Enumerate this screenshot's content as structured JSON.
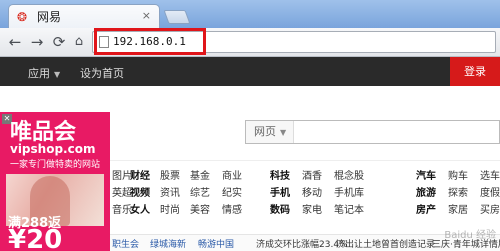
{
  "browser": {
    "tab": {
      "title": "网易",
      "favicon": "netease-logo-icon",
      "close": "×"
    },
    "nav": {
      "back": "←",
      "forward": "→",
      "reload": "⟳"
    },
    "omnibox": {
      "url": "192.168.0.1"
    },
    "highlight_color": "#e0151a"
  },
  "sitenav": {
    "apps": "应用",
    "set_home": "设为首页",
    "login": "登录",
    "login_color": "#d61a1a"
  },
  "ad": {
    "brand": "唯品会",
    "site": "vipshop.com",
    "slogan": "一家专门做特卖的网站",
    "promo": "满288返",
    "big": "¥20",
    "color": "#e81a64"
  },
  "search": {
    "type": "网页"
  },
  "links": {
    "col1": [
      "图片",
      "英超",
      "音乐"
    ],
    "col2": [
      "财经",
      "视频",
      "女人"
    ],
    "col3": [
      "股票",
      "资讯",
      "时尚"
    ],
    "col4": [
      "基金",
      "综艺",
      "美容"
    ],
    "col5": [
      "商业",
      "纪实",
      "情感"
    ],
    "col6": [
      "科技",
      "手机",
      "数码"
    ],
    "col7": [
      "酒香",
      "移动",
      "家电"
    ],
    "col8": [
      "棍念股",
      "手机库",
      "笔记本"
    ],
    "col9": [
      "汽车",
      "旅游",
      "房产"
    ],
    "col10": [
      "购车",
      "探索",
      "家居"
    ],
    "col11": [
      "选车",
      "度假",
      "买房"
    ]
  },
  "ticker": {
    "items": [
      "职生会",
      "绿城海新",
      "畅游中国",
      "济成交环比涨幅23.4%",
      "济出让土地曾首创造记录",
      "三庆·青年城详情展示"
    ]
  },
  "watermark": "Baidu 经验"
}
